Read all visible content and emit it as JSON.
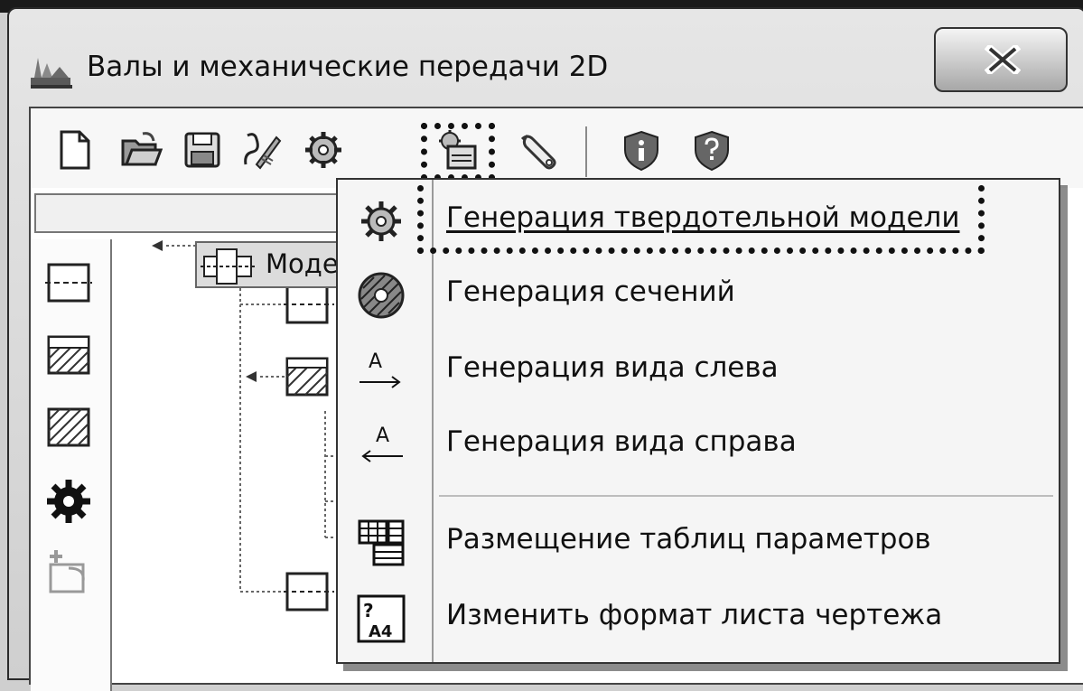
{
  "window": {
    "title": "Валы и механические передачи 2D"
  },
  "toolbar": {
    "buttons": [
      {
        "icon": "new-document-icon"
      },
      {
        "icon": "open-folder-icon"
      },
      {
        "icon": "save-icon"
      },
      {
        "icon": "edit-sketch-icon"
      },
      {
        "icon": "gear-icon"
      },
      {
        "icon": "generate-menu-icon"
      },
      {
        "icon": "wrench-icon"
      },
      {
        "icon": "info-shield-icon"
      },
      {
        "icon": "help-shield-icon"
      }
    ]
  },
  "tree": {
    "root_label": "Модель вала"
  },
  "menu": {
    "items": [
      {
        "label": "Генерация твердотельной модели",
        "icon": "gear-icon"
      },
      {
        "label": "Генерация сечений",
        "icon": "section-icon"
      },
      {
        "label": "Генерация вида слева",
        "icon": "left-view-arrow-icon",
        "icon_text": "А"
      },
      {
        "label": "Генерация вида справа",
        "icon": "right-view-arrow-icon",
        "icon_text": "А"
      },
      {
        "label": "Размещение таблиц параметров",
        "icon": "table-icon"
      },
      {
        "label": "Изменить формат листа чертежа",
        "icon": "sheet-format-icon",
        "icon_text": "А4"
      }
    ]
  }
}
